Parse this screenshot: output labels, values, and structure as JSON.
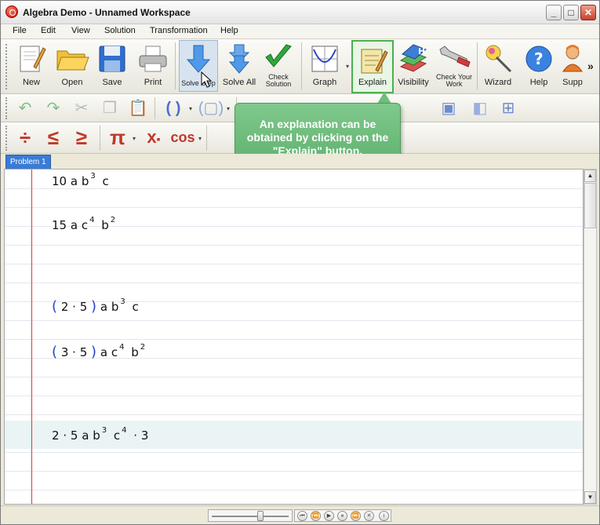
{
  "window": {
    "title": "Algebra Demo - Unnamed Workspace",
    "controls": {
      "minimize": "_",
      "maximize": "□",
      "close": "✕"
    }
  },
  "menu": [
    "File",
    "Edit",
    "View",
    "Solution",
    "Transformation",
    "Help"
  ],
  "toolbar": {
    "new": "New",
    "open": "Open",
    "save": "Save",
    "print": "Print",
    "solve_step": "Solve Step",
    "solve_all": "Solve All",
    "check_solution": "Check Solution",
    "graph": "Graph",
    "explain": "Explain",
    "visibility": "Visibility",
    "check_work": "Check Your Work",
    "wizard": "Wizard",
    "help": "Help",
    "support": "Supp",
    "more": "»"
  },
  "math_toolbar": {
    "divide": "÷",
    "less_equal": "≤",
    "greater_equal": "≥",
    "pi": "π",
    "subscript": "x",
    "cos": "cos"
  },
  "tabs": [
    "Problem 1"
  ],
  "tooltip": {
    "text": "An explanation can be obtained by clicking on the \"Explain\" button."
  },
  "worksheet": {
    "expr1": {
      "coef": "10",
      "a": "a",
      "b": "b",
      "b_exp": "3",
      "c": "c"
    },
    "expr2": {
      "coef": "15",
      "a": "a",
      "c": "c",
      "c_exp": "4",
      "b": "b",
      "b_exp": "2"
    },
    "expr3": {
      "n1": "2",
      "dot": "·",
      "n2": "5",
      "a": "a",
      "b": "b",
      "b_exp": "3",
      "c": "c"
    },
    "expr4": {
      "n1": "3",
      "dot": "·",
      "n2": "5",
      "a": "a",
      "c": "c",
      "c_exp": "4",
      "b": "b",
      "b_exp": "2"
    },
    "expr5": {
      "n1": "2",
      "dot": "·",
      "n2": "5",
      "a": "a",
      "b": "b",
      "b_exp": "3",
      "c": "c",
      "c_exp": "4",
      "dot2": "·",
      "n3": "3"
    }
  },
  "colors": {
    "margin_line": "#d43b3b",
    "paren": "#2a44c8",
    "tooltip": "#6fbe7c",
    "tab": "#3a7bd5",
    "math_red": "#c0392b"
  }
}
